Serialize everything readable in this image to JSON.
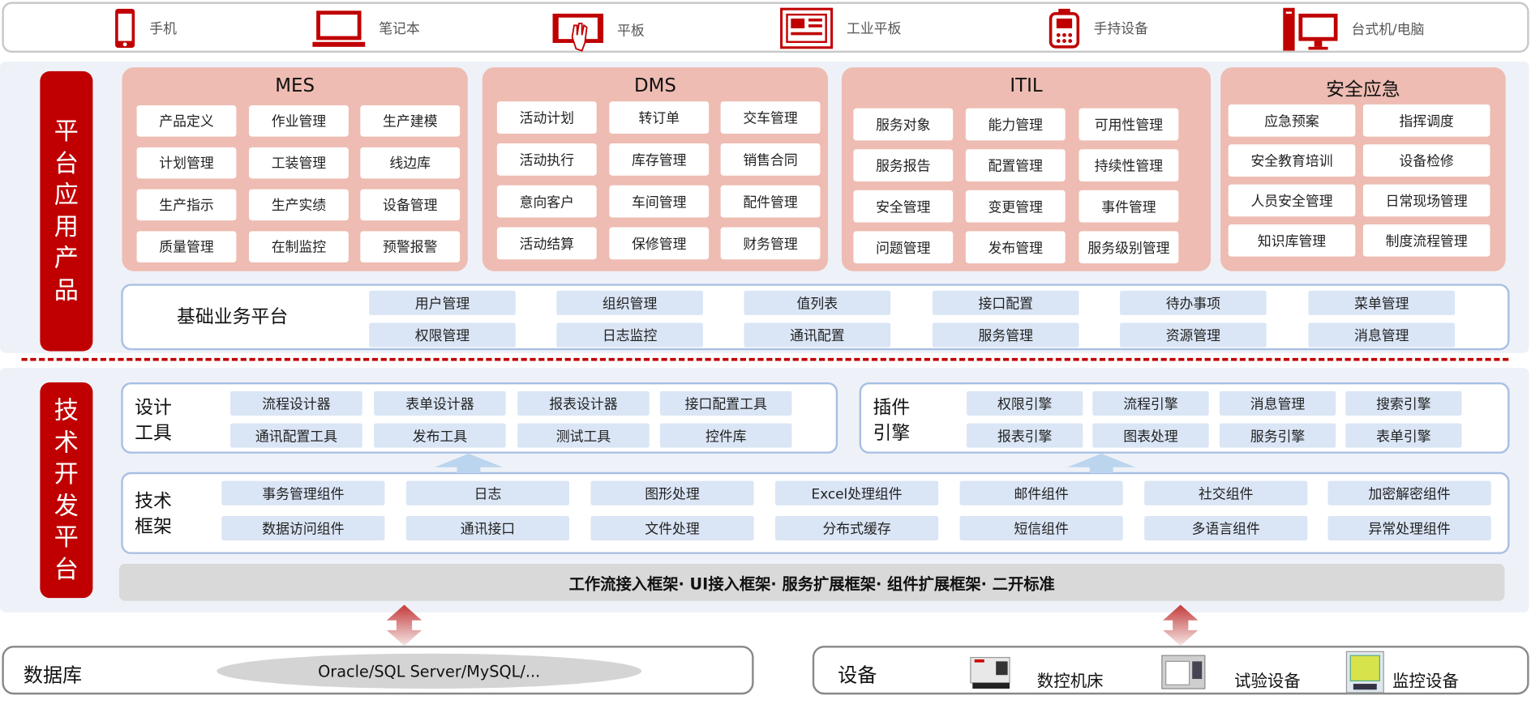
{
  "devices": [
    {
      "label": "手机",
      "icon": "phone-icon"
    },
    {
      "label": "笔记本",
      "icon": "laptop-icon"
    },
    {
      "label": "平板",
      "icon": "tablet-icon"
    },
    {
      "label": "工业平板",
      "icon": "industrial-tablet-icon"
    },
    {
      "label": "手持设备",
      "icon": "handheld-icon"
    },
    {
      "label": "台式机/电脑",
      "icon": "desktop-icon"
    }
  ],
  "platform_app": {
    "label": "平台应用产品",
    "groups": [
      {
        "title": "MES",
        "items": [
          "产品定义",
          "作业管理",
          "生产建模",
          "计划管理",
          "工装管理",
          "线边库",
          "生产指示",
          "生产实绩",
          "设备管理",
          "质量管理",
          "在制监控",
          "预警报警"
        ]
      },
      {
        "title": "DMS",
        "items": [
          "活动计划",
          "转订单",
          "交车管理",
          "活动执行",
          "库存管理",
          "销售合同",
          "意向客户",
          "车间管理",
          "配件管理",
          "活动结算",
          "保修管理",
          "财务管理"
        ]
      },
      {
        "title": "ITIL",
        "items": [
          "服务对象",
          "能力管理",
          "可用性管理",
          "服务报告",
          "配置管理",
          "持续性管理",
          "安全管理",
          "变更管理",
          "事件管理",
          "问题管理",
          "发布管理",
          "服务级别管理"
        ]
      },
      {
        "title": "安全应急",
        "items": [
          "应急预案",
          "指挥调度",
          "安全教育培训",
          "设备检修",
          "人员安全管理",
          "日常现场管理",
          "知识库管理",
          "制度流程管理"
        ]
      }
    ],
    "base": {
      "title": "基础业务平台",
      "items": [
        "用户管理",
        "组织管理",
        "值列表",
        "接口配置",
        "待办事项",
        "菜单管理",
        "权限管理",
        "日志监控",
        "通讯配置",
        "服务管理",
        "资源管理",
        "消息管理"
      ]
    }
  },
  "tech": {
    "label": "技术开发平台",
    "design": {
      "title": "设计工具",
      "items": [
        "流程设计器",
        "表单设计器",
        "报表设计器",
        "接口配置工具",
        "通讯配置工具",
        "发布工具",
        "测试工具",
        "控件库"
      ]
    },
    "plugin": {
      "title": "插件引擎",
      "items": [
        "权限引擎",
        "流程引擎",
        "消息管理",
        "搜索引擎",
        "报表引擎",
        "图表处理",
        "服务引擎",
        "表单引擎"
      ]
    },
    "framework": {
      "title": "技术框架",
      "items": [
        "事务管理组件",
        "日志",
        "图形处理",
        "Excel处理组件",
        "邮件组件",
        "社交组件",
        "加密解密组件",
        "数据访问组件",
        "通讯接口",
        "文件处理",
        "分布式缓存",
        "短信组件",
        "多语言组件",
        "异常处理组件"
      ]
    },
    "bar": "工作流接入框架· UI接入框架· 服务扩展框架· 组件扩展框架· 二开标准"
  },
  "database": {
    "title": "数据库",
    "value": "Oracle/SQL Server/MySQL/..."
  },
  "equipment": {
    "title": "设备",
    "items": [
      "数控机床",
      "试验设备",
      "监控设备"
    ]
  },
  "colors": {
    "red": "#c00000",
    "pink": "#eebcb2",
    "blue_cell": "#dae5f5"
  }
}
